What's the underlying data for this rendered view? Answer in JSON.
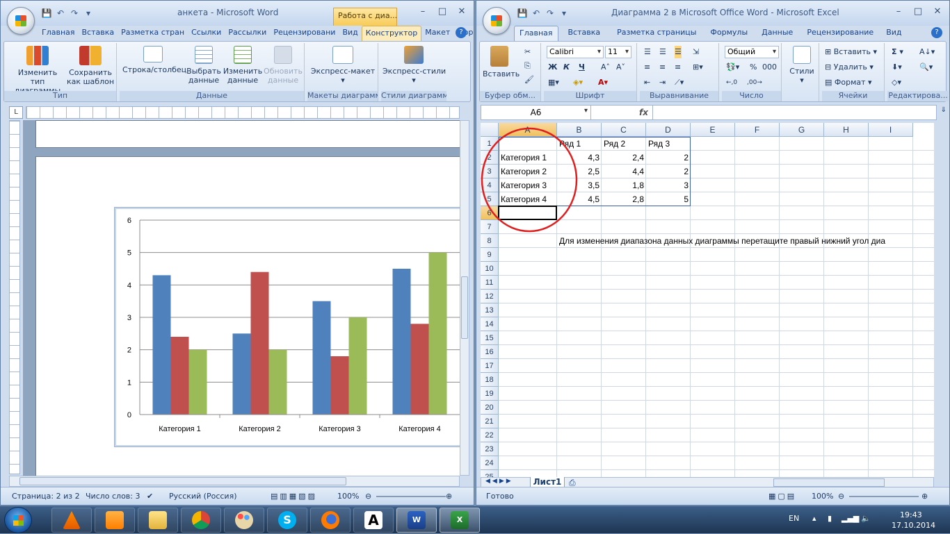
{
  "word": {
    "title": "анкета - Microsoft Word",
    "context_group": "Работа с диа...",
    "tabs": [
      "Главная",
      "Вставка",
      "Разметка стран",
      "Ссылки",
      "Рассылки",
      "Рецензировани",
      "Вид",
      "Конструктор",
      "Макет",
      "Формат"
    ],
    "active_tab": "Конструктор",
    "groups": [
      {
        "label": "Тип",
        "buttons": [
          "Изменить тип диаграммы",
          "Сохранить как шаблон"
        ]
      },
      {
        "label": "Данные",
        "buttons": [
          "Строка/столбец",
          "Выбрать данные",
          "Изменить данные",
          "Обновить данные"
        ]
      },
      {
        "label": "Макеты диаграмм",
        "buttons": [
          "Экспресс-макет"
        ]
      },
      {
        "label": "Стили диаграмм",
        "buttons": [
          "Экспресс-стили"
        ]
      }
    ],
    "ruler_corner": "L",
    "status": {
      "page": "Страница: 2 из 2",
      "words": "Число слов: 3",
      "lang": "Русский (Россия)",
      "zoom": "100%"
    }
  },
  "excel": {
    "title": "Диаграмма 2 в Microsoft Office Word - Microsoft Excel",
    "tabs": [
      "Главная",
      "Вставка",
      "Разметка страницы",
      "Формулы",
      "Данные",
      "Рецензирование",
      "Вид"
    ],
    "active_tab": "Главная",
    "groups": {
      "clipboard": "Буфер обм...",
      "font": "Шрифт",
      "align": "Выравнивание",
      "number": "Число",
      "styles": "Стили",
      "cells": "Ячейки",
      "editing": "Редактирова..."
    },
    "paste_label": "Вставить",
    "font_name": "Calibri",
    "font_size": "11",
    "number_format": "Общий",
    "cells_insert": "Вставить",
    "cells_delete": "Удалить",
    "cells_format": "Формат",
    "name_box": "A6",
    "fx": "fx",
    "columns": [
      "A",
      "B",
      "C",
      "D",
      "E",
      "F",
      "G",
      "H",
      "I"
    ],
    "rows": [
      "1",
      "2",
      "3",
      "4",
      "5",
      "6",
      "7",
      "8",
      "9",
      "10",
      "11",
      "12",
      "13",
      "14",
      "15",
      "16",
      "17",
      "18",
      "19",
      "20",
      "21",
      "22",
      "23",
      "24",
      "25"
    ],
    "cells": {
      "B1": "Ряд 1",
      "C1": "Ряд 2",
      "D1": "Ряд 3",
      "A2": "Категория 1",
      "B2": "4,3",
      "C2": "2,4",
      "D2": "2",
      "A3": "Категория 2",
      "B3": "2,5",
      "C3": "4,4",
      "D3": "2",
      "A4": "Категория 3",
      "B4": "3,5",
      "C4": "1,8",
      "D4": "3",
      "A5": "Категория 4",
      "B5": "4,5",
      "C5": "2,8",
      "D5": "5",
      "B8": "Для изменения диапазона данных диаграммы перетащите правый нижний угол диа"
    },
    "sheet_tab": "Лист1",
    "status": {
      "ready": "Готово",
      "zoom": "100%"
    }
  },
  "taskbar": {
    "lang": "EN",
    "time": "19:43",
    "date": "17.10.2014"
  },
  "chart_data": {
    "type": "bar",
    "categories": [
      "Категория 1",
      "Категория 2",
      "Категория 3",
      "Категория 4"
    ],
    "series": [
      {
        "name": "Ряд 1",
        "values": [
          4.3,
          2.5,
          3.5,
          4.5
        ],
        "color": "#4f81bd"
      },
      {
        "name": "Ряд 2",
        "values": [
          2.4,
          4.4,
          1.8,
          2.8
        ],
        "color": "#c0504d"
      },
      {
        "name": "Ряд 3",
        "values": [
          2,
          2,
          3,
          5
        ],
        "color": "#9bbb59"
      }
    ],
    "ylim": [
      0,
      6
    ],
    "yticks": [
      "0",
      "1",
      "2",
      "3",
      "4",
      "5",
      "6"
    ],
    "grid": true
  }
}
